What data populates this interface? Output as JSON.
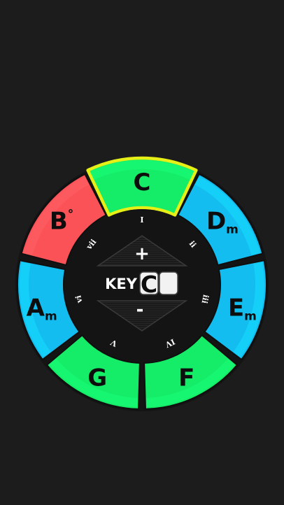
{
  "colors": {
    "background": "#1c1c1c",
    "major": "#15ec67",
    "minor": "#13bdf0",
    "diminished": "#fb5257",
    "selected_outline": "#e6ef16",
    "center": "#141414"
  },
  "chords": [
    {
      "id": "c",
      "root": "C",
      "suffix": "",
      "numeral": "I",
      "quality": "major",
      "selected": true
    },
    {
      "id": "dm",
      "root": "D",
      "suffix": "m",
      "numeral": "ii",
      "quality": "minor",
      "selected": false
    },
    {
      "id": "em",
      "root": "E",
      "suffix": "m",
      "numeral": "iii",
      "quality": "minor",
      "selected": false
    },
    {
      "id": "f",
      "root": "F",
      "suffix": "",
      "numeral": "IV",
      "quality": "major",
      "selected": false
    },
    {
      "id": "g",
      "root": "G",
      "suffix": "",
      "numeral": "V",
      "quality": "major",
      "selected": false
    },
    {
      "id": "am",
      "root": "A",
      "suffix": "m",
      "numeral": "vi",
      "quality": "minor",
      "selected": false
    },
    {
      "id": "bdim",
      "root": "B",
      "suffix": "°",
      "numeral": "vii",
      "quality": "diminished",
      "selected": false
    }
  ],
  "key": {
    "label": "KEY",
    "value": "C",
    "accidental": "",
    "up_label": "+",
    "down_label": "-"
  }
}
